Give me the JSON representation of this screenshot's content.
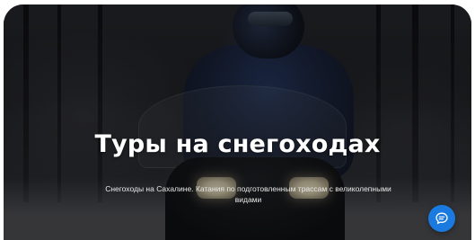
{
  "hero": {
    "title": "Туры на снегоходах",
    "subtitle": "Снегоходы на Сахалине. Катания по подготовленным трассам с великолепными видами",
    "background_image": "snowmobile-rider-winter-forest"
  },
  "chat_widget": {
    "icon": "chat-bubble-icon",
    "color": "#1a7ae0"
  },
  "colors": {
    "title_text": "#ffffff",
    "subtitle_text": "#e8e8e8",
    "chat_button": "#1a7ae0"
  }
}
